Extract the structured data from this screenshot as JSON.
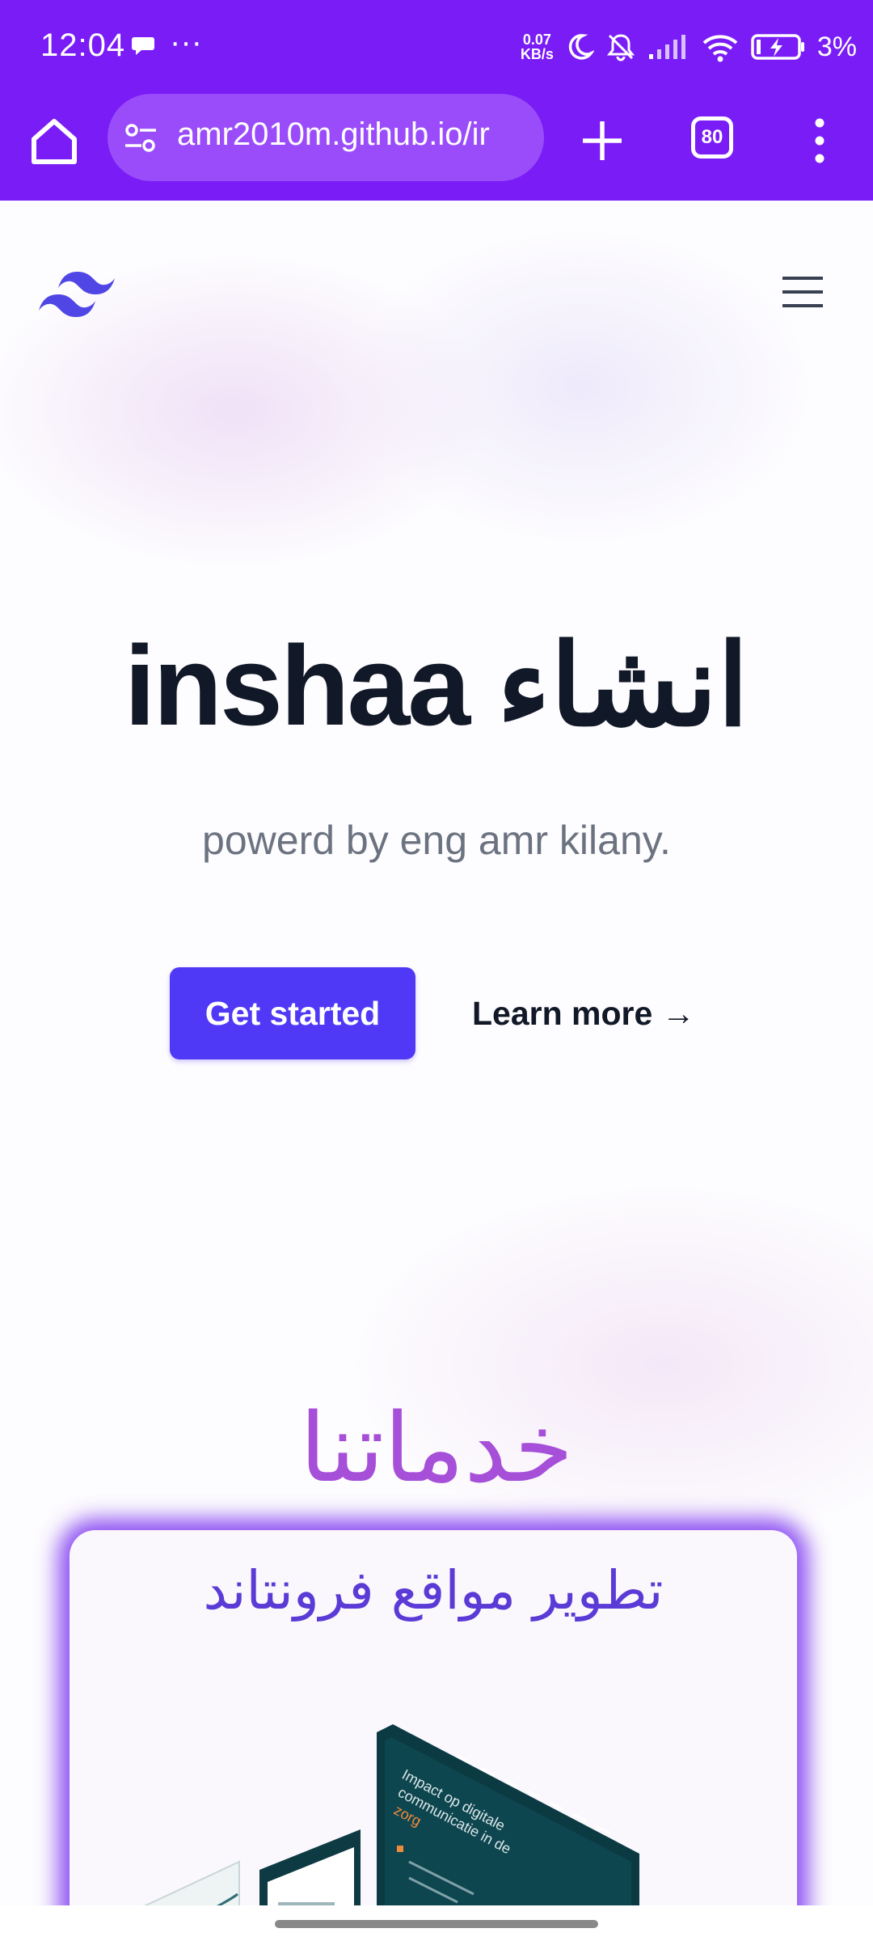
{
  "status_bar": {
    "time": "12:04",
    "more": "···",
    "net_speed_value": "0.07",
    "net_speed_unit": "KB/s",
    "battery": "3%"
  },
  "browser": {
    "url": "amr2010m.github.io/ir",
    "tab_count": "80"
  },
  "page": {
    "title": "inshaa انشاء",
    "subtitle": "powerd by eng amr kilany.",
    "primary_button": "Get started",
    "secondary_link": "Learn more →",
    "services_heading": "خدماتنا",
    "card_title": "تطوير مواقع فرونتاند",
    "card_image_text_1": "Impact op digitale",
    "card_image_text_2": "communicatie in de",
    "card_image_text_3": "zorg"
  },
  "colors": {
    "chrome": "#7a1cf6",
    "primary": "#4f39f6",
    "heading_purple": "#a64fd8",
    "card_glow": "#7a32f0"
  }
}
